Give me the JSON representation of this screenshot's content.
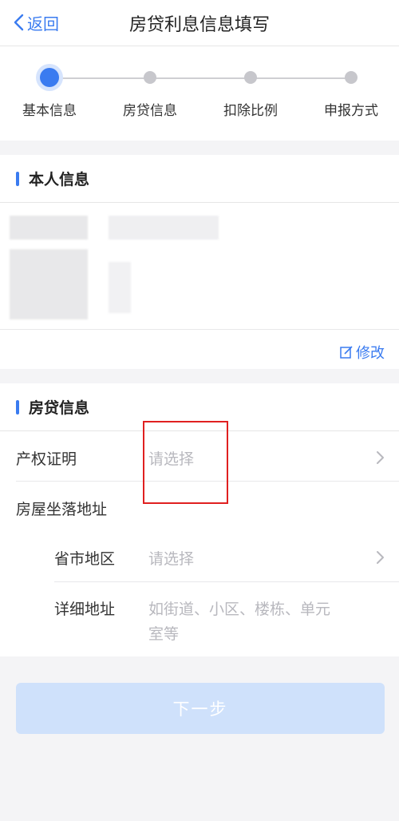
{
  "navbar": {
    "back_label": "返回",
    "title": "房贷利息信息填写"
  },
  "steps": [
    {
      "label": "基本信息",
      "active": true
    },
    {
      "label": "房贷信息",
      "active": false
    },
    {
      "label": "扣除比例",
      "active": false
    },
    {
      "label": "申报方式",
      "active": false
    }
  ],
  "personal": {
    "title": "本人信息",
    "edit_label": "修改"
  },
  "loan": {
    "title": "房贷信息",
    "property_cert": {
      "label": "产权证明",
      "placeholder": "请选择"
    },
    "address_label": "房屋坐落地址",
    "region": {
      "label": "省市地区",
      "placeholder": "请选择"
    },
    "detail": {
      "label": "详细地址",
      "placeholder_line1": "如街道、小区、楼栋、单元",
      "placeholder_line2": "室等"
    }
  },
  "footer": {
    "next_label": "下一步"
  },
  "colors": {
    "accent": "#3a7bf0",
    "highlight": "#e02020",
    "button_disabled": "#cfe1fb"
  }
}
